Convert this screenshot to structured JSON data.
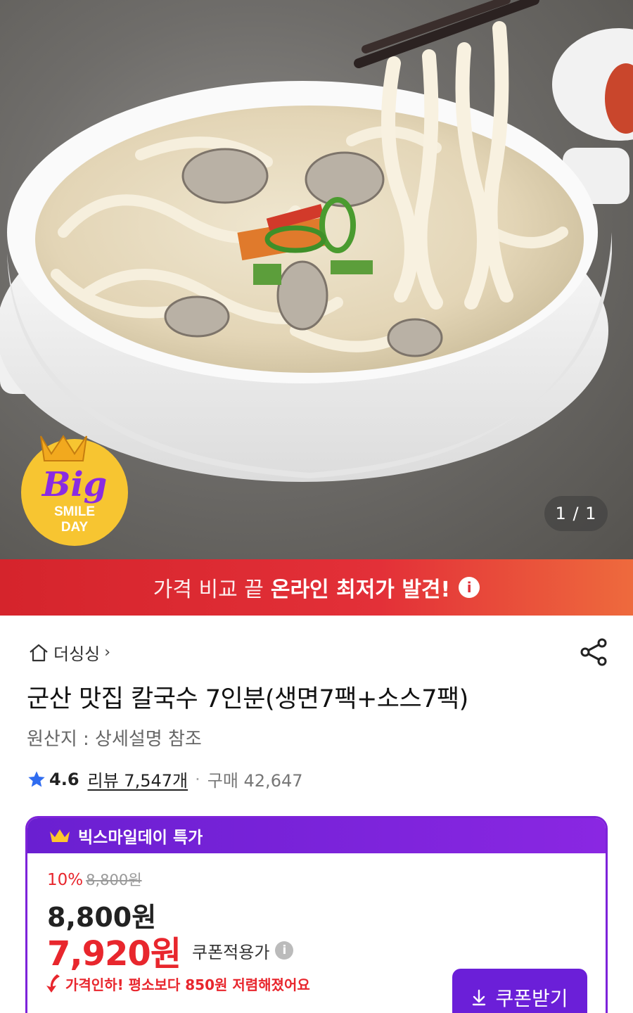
{
  "hero": {
    "counter": "1 / 1",
    "badge": {
      "big": "Big",
      "line1": "SMILE",
      "line2": "DAY"
    }
  },
  "promo": {
    "prefix": "가격 비교 끝",
    "highlight": "온라인 최저가 발견!",
    "info_icon": "info-icon"
  },
  "product": {
    "store": "더싱싱",
    "title": "군산 맛집 칼국수 7인분(생면7팩+소스7팩)",
    "origin": "원산지 : 상세설명 참조",
    "rating": "4.6",
    "review": "리뷰 7,547개",
    "purchase": "구매 42,647"
  },
  "deal": {
    "header": "빅스마일데이 특가",
    "discount_pct": "10%",
    "original_price": "8,800원",
    "price": "8,800원",
    "coupon_price": "7,920원",
    "coupon_label": "쿠폰적용가",
    "drop_text": "가격인하! 평소보다 850원 저렴해졌어요",
    "coupon_button": "쿠폰받기"
  },
  "colors": {
    "accent_red": "#e8262d",
    "deal_purple": "#6b1fd8",
    "banner_red": "#d5242c"
  }
}
